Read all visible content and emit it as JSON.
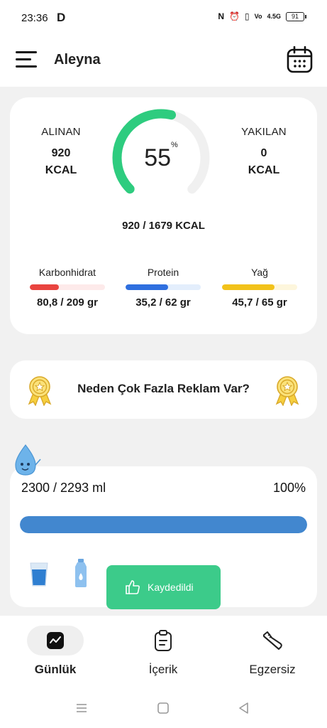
{
  "status_bar": {
    "time": "23:36",
    "app_glyph": "D",
    "network": "4.5G",
    "battery": "91"
  },
  "header": {
    "title": "Aleyna",
    "menu_icon": "hamburger-menu-icon",
    "calendar_icon": "calendar-icon"
  },
  "calories": {
    "taken_label": "ALINAN",
    "taken_value": "920",
    "taken_unit": "KCAL",
    "burned_label": "YAKILAN",
    "burned_value": "0",
    "burned_unit": "KCAL",
    "percent": "55",
    "percent_sign": "%",
    "progress": 0.55,
    "total": "920 / 1679 KCAL",
    "accent_color": "#2ecc7f"
  },
  "macros": [
    {
      "label": "Karbonhidrat",
      "value": "80,8 / 209 gr",
      "progress": 0.39,
      "color": "#e9443f",
      "track": "#fdeaea"
    },
    {
      "label": "Protein",
      "value": "35,2 / 62 gr",
      "progress": 0.57,
      "color": "#2f6fdf",
      "track": "#e3eefc"
    },
    {
      "label": "Yağ",
      "value": "45,7 / 65 gr",
      "progress": 0.7,
      "color": "#f2c21a",
      "track": "#fdf6dc"
    }
  ],
  "ad": {
    "text": "Neden Çok Fazla Reklam Var?"
  },
  "water": {
    "amount": "2300 / 2293 ml",
    "percent": "100%",
    "progress": 1.0,
    "color": "#4287cf"
  },
  "toast": {
    "text": "Kaydedildi",
    "icon": "thumbs-up-icon",
    "color": "#3ccb8a"
  },
  "bottom_nav": [
    {
      "label": "Günlük",
      "icon": "chart-line-icon",
      "active": true
    },
    {
      "label": "İçerik",
      "icon": "clipboard-icon",
      "active": false
    },
    {
      "label": "Egzersiz",
      "icon": "sneaker-icon",
      "active": false
    }
  ]
}
